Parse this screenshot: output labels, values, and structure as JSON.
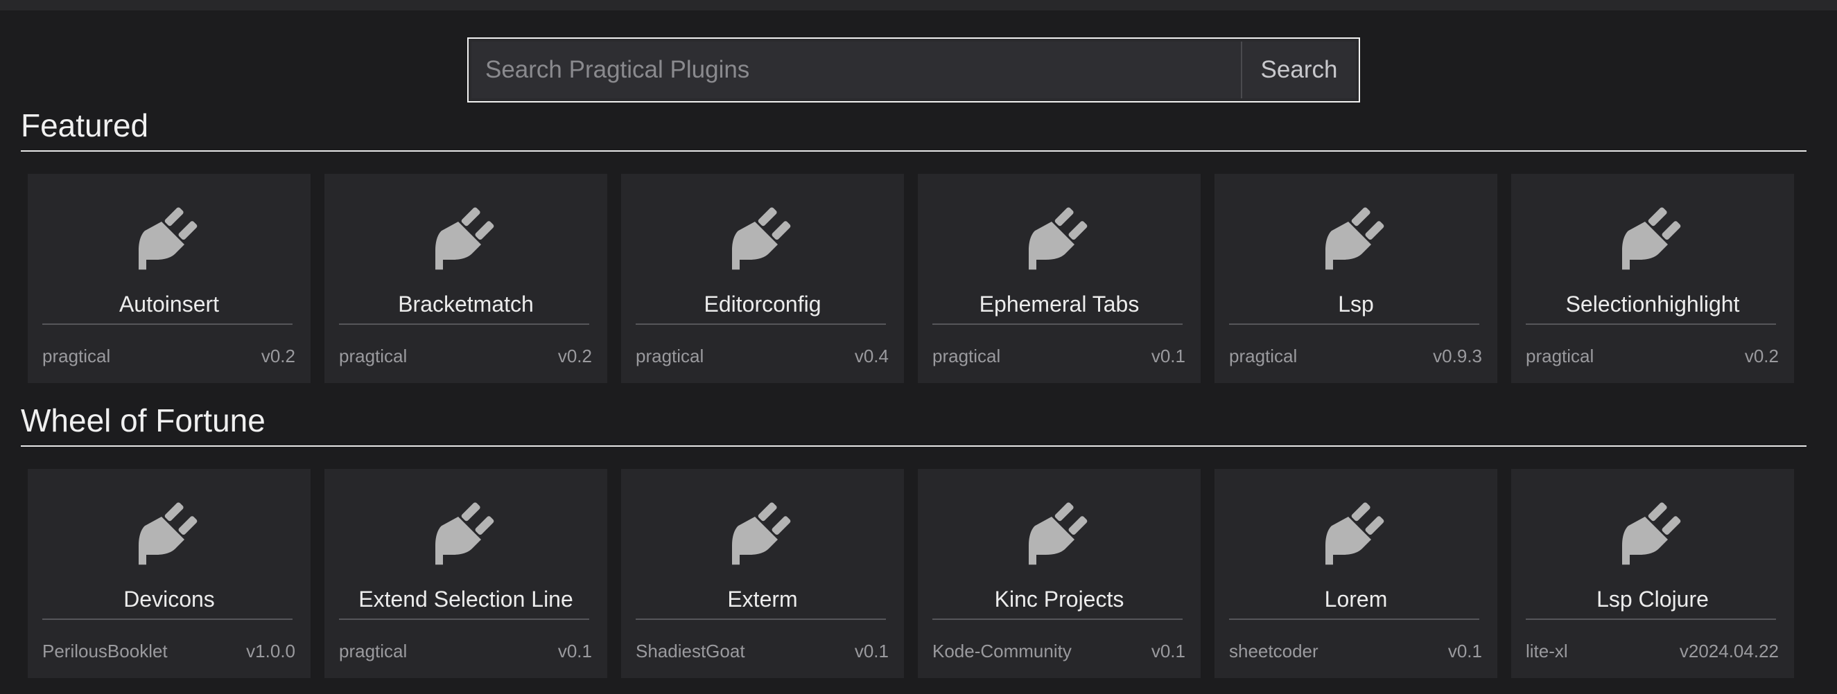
{
  "search": {
    "placeholder": "Search Pragtical Plugins",
    "button_label": "Search"
  },
  "featured": {
    "title": "Featured",
    "plugins": [
      {
        "name": "Autoinsert",
        "author": "pragtical",
        "version": "v0.2",
        "icon": "plug-icon"
      },
      {
        "name": "Bracketmatch",
        "author": "pragtical",
        "version": "v0.2",
        "icon": "plug-icon"
      },
      {
        "name": "Editorconfig",
        "author": "pragtical",
        "version": "v0.4",
        "icon": "plug-icon"
      },
      {
        "name": "Ephemeral Tabs",
        "author": "pragtical",
        "version": "v0.1",
        "icon": "plug-icon"
      },
      {
        "name": "Lsp",
        "author": "pragtical",
        "version": "v0.9.3",
        "icon": "plug-icon"
      },
      {
        "name": "Selectionhighlight",
        "author": "pragtical",
        "version": "v0.2",
        "icon": "plug-icon"
      }
    ]
  },
  "wheel": {
    "title": "Wheel of Fortune",
    "plugins": [
      {
        "name": "Devicons",
        "author": "PerilousBooklet",
        "version": "v1.0.0",
        "icon": "plug-icon"
      },
      {
        "name": "Extend Selection Line",
        "author": "pragtical",
        "version": "v0.1",
        "icon": "plug-icon"
      },
      {
        "name": "Exterm",
        "author": "ShadiestGoat",
        "version": "v0.1",
        "icon": "plug-icon"
      },
      {
        "name": "Kinc Projects",
        "author": "Kode-Community",
        "version": "v0.1",
        "icon": "plug-icon"
      },
      {
        "name": "Lorem",
        "author": "sheetcoder",
        "version": "v0.1",
        "icon": "plug-icon"
      },
      {
        "name": "Lsp Clojure",
        "author": "lite-xl",
        "version": "v2024.04.22",
        "icon": "plug-icon"
      }
    ]
  },
  "colors": {
    "background": "#1c1c1e",
    "card": "#27272a",
    "icon": "#b4b4b4",
    "rule": "#e8e8e8"
  }
}
